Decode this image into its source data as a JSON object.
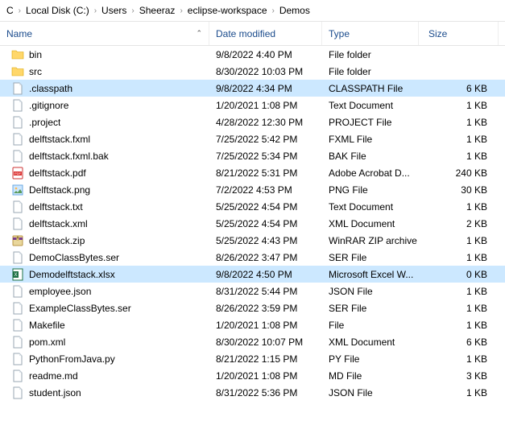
{
  "breadcrumb": [
    "C",
    "Local Disk (C:)",
    "Users",
    "Sheeraz",
    "eclipse-workspace",
    "Demos"
  ],
  "headers": {
    "name": "Name",
    "date": "Date modified",
    "type": "Type",
    "size": "Size"
  },
  "files": [
    {
      "icon": "folder",
      "name": "bin",
      "date": "9/8/2022 4:40 PM",
      "type": "File folder",
      "size": "",
      "sel": false
    },
    {
      "icon": "folder",
      "name": "src",
      "date": "8/30/2022 10:03 PM",
      "type": "File folder",
      "size": "",
      "sel": false
    },
    {
      "icon": "file",
      "name": ".classpath",
      "date": "9/8/2022 4:34 PM",
      "type": "CLASSPATH File",
      "size": "6 KB",
      "sel": true
    },
    {
      "icon": "file",
      "name": ".gitignore",
      "date": "1/20/2021 1:08 PM",
      "type": "Text Document",
      "size": "1 KB",
      "sel": false
    },
    {
      "icon": "file",
      "name": ".project",
      "date": "4/28/2022 12:30 PM",
      "type": "PROJECT File",
      "size": "1 KB",
      "sel": false
    },
    {
      "icon": "file",
      "name": "delftstack.fxml",
      "date": "7/25/2022 5:42 PM",
      "type": "FXML File",
      "size": "1 KB",
      "sel": false
    },
    {
      "icon": "file",
      "name": "delftstack.fxml.bak",
      "date": "7/25/2022 5:34 PM",
      "type": "BAK File",
      "size": "1 KB",
      "sel": false
    },
    {
      "icon": "pdf",
      "name": "delftstack.pdf",
      "date": "8/21/2022 5:31 PM",
      "type": "Adobe Acrobat D...",
      "size": "240 KB",
      "sel": false
    },
    {
      "icon": "png",
      "name": "Delftstack.png",
      "date": "7/2/2022 4:53 PM",
      "type": "PNG File",
      "size": "30 KB",
      "sel": false
    },
    {
      "icon": "file",
      "name": "delftstack.txt",
      "date": "5/25/2022 4:54 PM",
      "type": "Text Document",
      "size": "1 KB",
      "sel": false
    },
    {
      "icon": "file",
      "name": "delftstack.xml",
      "date": "5/25/2022 4:54 PM",
      "type": "XML Document",
      "size": "2 KB",
      "sel": false
    },
    {
      "icon": "zip",
      "name": "delftstack.zip",
      "date": "5/25/2022 4:43 PM",
      "type": "WinRAR ZIP archive",
      "size": "1 KB",
      "sel": false
    },
    {
      "icon": "file",
      "name": "DemoClassBytes.ser",
      "date": "8/26/2022 3:47 PM",
      "type": "SER File",
      "size": "1 KB",
      "sel": false
    },
    {
      "icon": "xlsx",
      "name": "Demodelftstack.xlsx",
      "date": "9/8/2022 4:50 PM",
      "type": "Microsoft Excel W...",
      "size": "0 KB",
      "sel": true
    },
    {
      "icon": "file",
      "name": "employee.json",
      "date": "8/31/2022 5:44 PM",
      "type": "JSON File",
      "size": "1 KB",
      "sel": false
    },
    {
      "icon": "file",
      "name": "ExampleClassBytes.ser",
      "date": "8/26/2022 3:59 PM",
      "type": "SER File",
      "size": "1 KB",
      "sel": false
    },
    {
      "icon": "file",
      "name": "Makefile",
      "date": "1/20/2021 1:08 PM",
      "type": "File",
      "size": "1 KB",
      "sel": false
    },
    {
      "icon": "file",
      "name": "pom.xml",
      "date": "8/30/2022 10:07 PM",
      "type": "XML Document",
      "size": "6 KB",
      "sel": false
    },
    {
      "icon": "file",
      "name": "PythonFromJava.py",
      "date": "8/21/2022 1:15 PM",
      "type": "PY File",
      "size": "1 KB",
      "sel": false
    },
    {
      "icon": "file",
      "name": "readme.md",
      "date": "1/20/2021 1:08 PM",
      "type": "MD File",
      "size": "3 KB",
      "sel": false
    },
    {
      "icon": "file",
      "name": "student.json",
      "date": "8/31/2022 5:36 PM",
      "type": "JSON File",
      "size": "1 KB",
      "sel": false
    }
  ]
}
